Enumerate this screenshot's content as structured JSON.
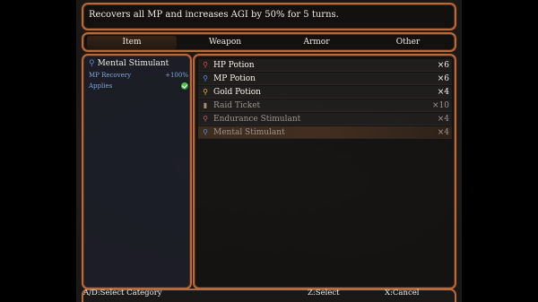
{
  "help": {
    "text": "Recovers all MP and increases AGI by 50% for 5 turns."
  },
  "tabs": [
    {
      "label": "Item",
      "active": true
    },
    {
      "label": "Weapon",
      "active": false
    },
    {
      "label": "Armor",
      "active": false
    },
    {
      "label": "Other",
      "active": false
    }
  ],
  "detail": {
    "name": "Mental Stimulant",
    "icon": "blue-flask-icon",
    "stats": [
      {
        "label": "MP Recovery",
        "value": "+100%"
      },
      {
        "label": "Applies",
        "value": ""
      }
    ]
  },
  "items": [
    {
      "name": "HP Potion",
      "qty": "×6",
      "icon": "red-potion-icon",
      "enabled": true,
      "selected": false
    },
    {
      "name": "MP Potion",
      "qty": "×6",
      "icon": "blue-potion-icon",
      "enabled": true,
      "selected": false
    },
    {
      "name": "Gold Potion",
      "qty": "×4",
      "icon": "gold-potion-icon",
      "enabled": true,
      "selected": false
    },
    {
      "name": "Raid Ticket",
      "qty": "×10",
      "icon": "ticket-icon",
      "enabled": false,
      "selected": false
    },
    {
      "name": "Endurance Stimulant",
      "qty": "×4",
      "icon": "red-flask-icon",
      "enabled": false,
      "selected": false
    },
    {
      "name": "Mental Stimulant",
      "qty": "×4",
      "icon": "blue-flask-icon",
      "enabled": false,
      "selected": true
    }
  ],
  "footer": {
    "category": "A/D:Select Category",
    "select": "Z:Select",
    "cancel": "X:Cancel"
  },
  "colors": {
    "frame": "#b86a3a",
    "stat_label": "#7fa6d8",
    "applies_ok": "#4fc24a"
  }
}
